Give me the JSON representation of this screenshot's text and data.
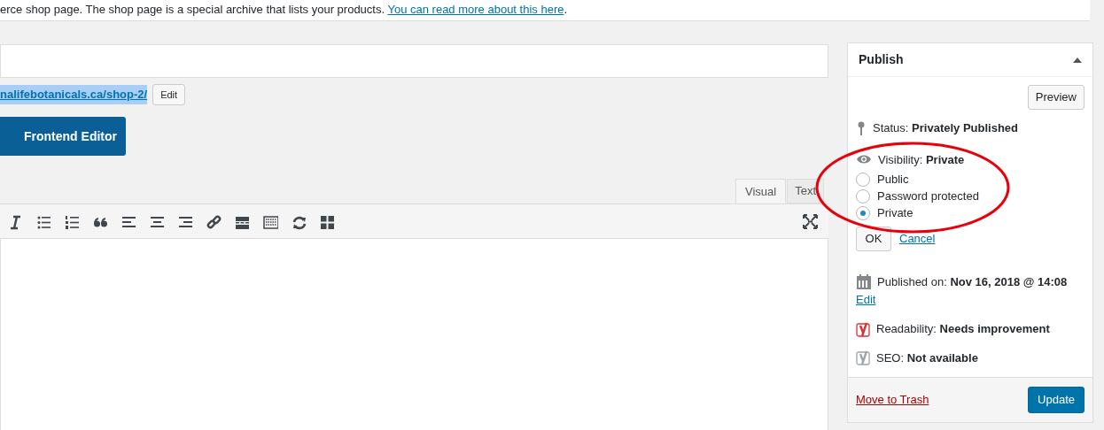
{
  "notice": {
    "text": "erce shop page. The shop page is a special archive that lists your products.",
    "link": "You can read more about this here",
    "end": "."
  },
  "permalink": {
    "url": "nalifebotanicals.ca/shop-2/",
    "selected": true,
    "edit": "Edit"
  },
  "frontend_button": "Frontend Editor",
  "editor_tabs": [
    {
      "label": "Visual",
      "selected": true
    },
    {
      "label": "Text",
      "selected": false
    }
  ],
  "publish": {
    "title": "Publish",
    "preview": "Preview",
    "status": {
      "label": "Status:",
      "value": "Privately Published"
    },
    "visibility": {
      "label": "Visibility:",
      "value": "Private"
    },
    "options": [
      {
        "label": "Public",
        "selected": false
      },
      {
        "label": "Password protected",
        "selected": false
      },
      {
        "label": "Private",
        "selected": true
      }
    ],
    "ok": "OK",
    "cancel": "Cancel",
    "published": {
      "label": "Published on:",
      "value": "Nov 16, 2018 @ 14:08",
      "edit": "Edit"
    },
    "readability": {
      "label": "Readability:",
      "value": "Needs improvement",
      "color": "#dc3232"
    },
    "seo": {
      "label": "SEO:",
      "value": "Not available",
      "color": "#a0a5aa"
    },
    "trash": "Move to Trash",
    "update": "Update"
  }
}
